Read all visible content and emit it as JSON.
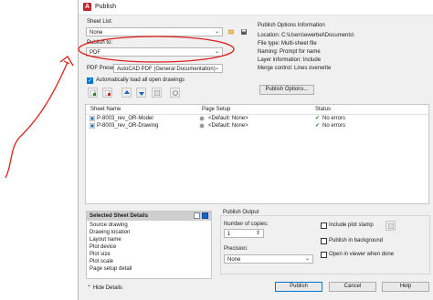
{
  "dialog": {
    "title": "Publish",
    "sheet_list_label": "Sheet List:",
    "sheet_list_value": "None",
    "publish_to_label": "Publish to:",
    "publish_to_value": "PDF",
    "pdf_preset_label": "PDF Preset:",
    "pdf_preset_value": "AutoCAD PDF (General Documentation)",
    "auto_load_label": "Automatically load all open drawings",
    "auto_load_checked": true
  },
  "publish_options_info": {
    "heading": "Publish Options Information",
    "lines": [
      "Location: C:\\Users\\ewerbel\\Documents\\",
      "File type: Multi-sheet file",
      "Naming: Prompt for name",
      "Layer information: Include",
      "Merge control: Lines overwrite"
    ],
    "button_label": "Publish Options..."
  },
  "sheet_table": {
    "columns": [
      "Sheet Name",
      "Page Setup",
      "Status"
    ],
    "rows": [
      {
        "sheet": "P-8003_rev_OR-Model",
        "setup": "<Default: None>",
        "status": "No errors"
      },
      {
        "sheet": "P-8003_rev_OR-Drawing",
        "setup": "<Default: None>",
        "status": "No errors"
      }
    ]
  },
  "selected_sheet_details": {
    "heading": "Selected Sheet Details",
    "items": [
      "Source drawing",
      "Drawing location",
      "Layout name",
      "Plot device",
      "Plot size",
      "Plot scale",
      "Page setup detail"
    ]
  },
  "publish_output": {
    "heading": "Publish Output",
    "copies_label": "Number of copies:",
    "copies_value": "1",
    "precision_label": "Precision:",
    "precision_value": "None",
    "include_stamp_label": "Include plot stamp",
    "background_label": "Publish in background",
    "open_viewer_label": "Open in viewer when done"
  },
  "footer": {
    "hide_details": "Hide Details",
    "publish": "Publish",
    "cancel": "Cancel",
    "help": "Help"
  },
  "annotation": {
    "color": "#e0201b"
  }
}
